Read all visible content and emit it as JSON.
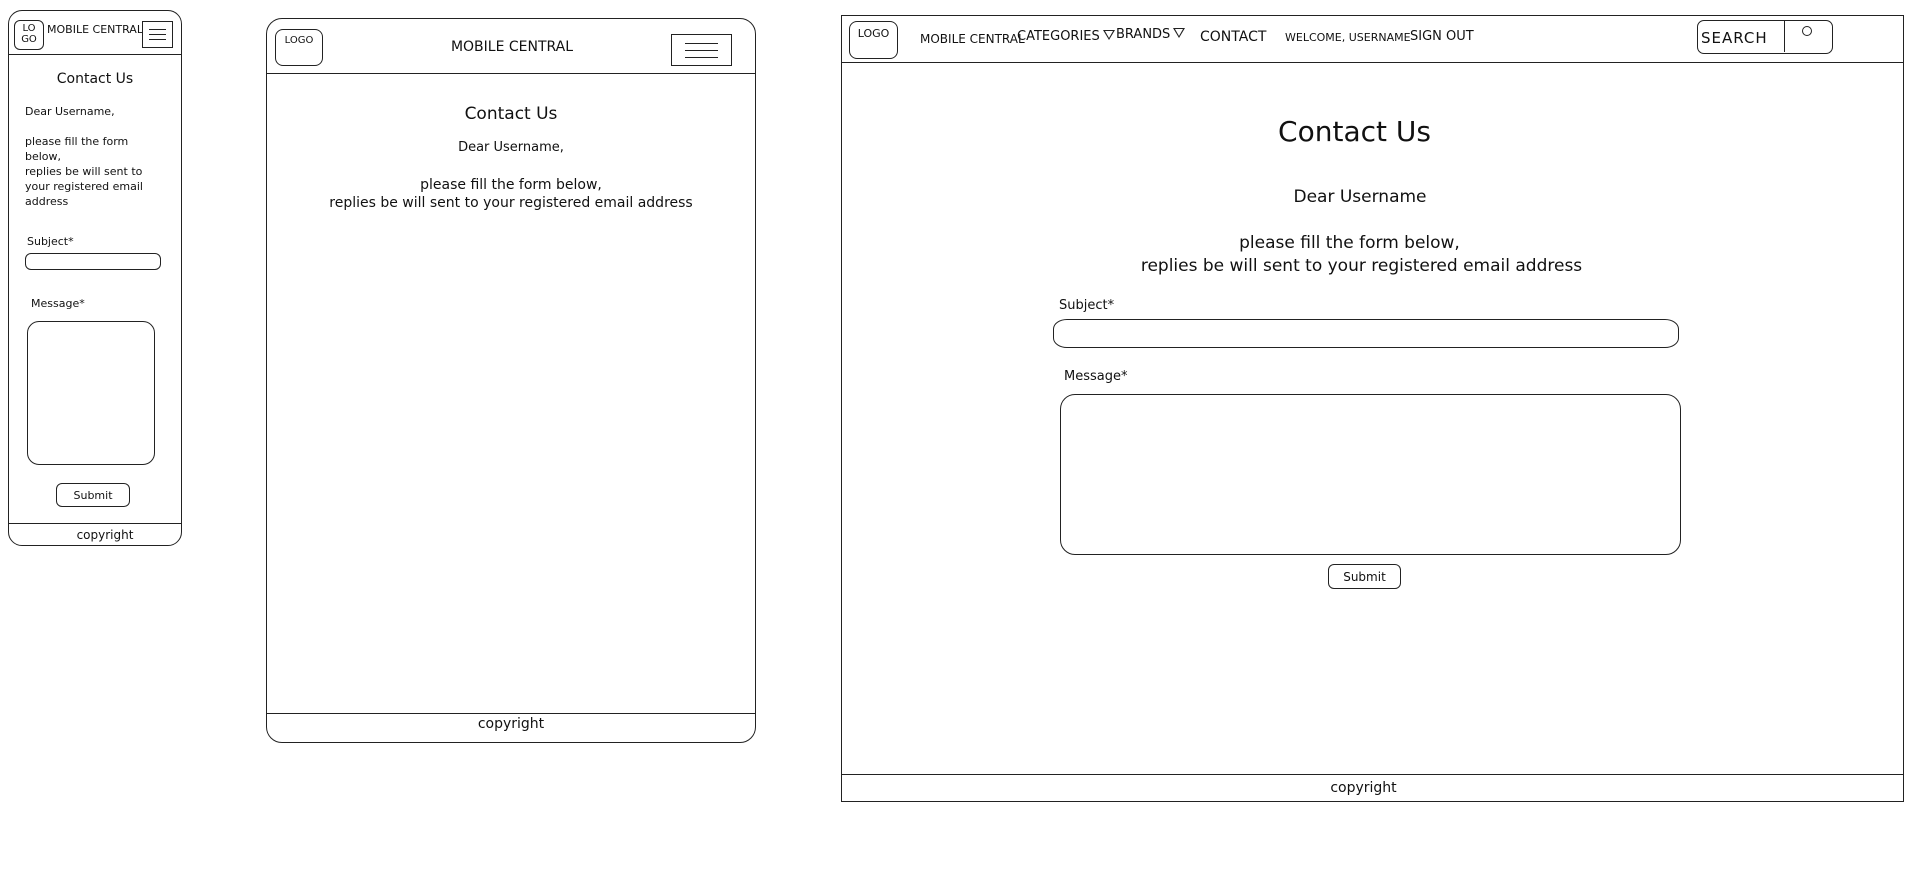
{
  "mobile": {
    "logo": "LO\nGO",
    "brand": "MOBILE CENTRAL",
    "page_title": "Contact Us",
    "greeting": "Dear Username,",
    "instructions_1": "please fill the form",
    "instructions_2": "below,",
    "instructions_3": "replies be will sent to",
    "instructions_4": "your registered email",
    "instructions_5": "address",
    "subject_label": "Subject*",
    "message_label": "Message*",
    "submit_label": "Submit",
    "footer": "copyright"
  },
  "tablet": {
    "logo": "LOGO",
    "brand": "MOBILE CENTRAL",
    "page_title": "Contact Us",
    "greeting": "Dear Username,",
    "instructions_1": "please fill the form below,",
    "instructions_2": "replies be will sent to your registered email address",
    "footer": "copyright"
  },
  "desktop": {
    "logo": "LOGO",
    "nav": {
      "brand": "MOBILE CENTRAL",
      "categories": "CATEGORIES",
      "brands": "BRANDS",
      "contact": "CONTACT",
      "welcome": "WELCOME, USERNAME",
      "sign_out": "SIGN OUT"
    },
    "search_label": "SEARCH",
    "page_title": "Contact Us",
    "greeting": "Dear Username",
    "instructions_1": "please fill the form below,",
    "instructions_2": "replies be will sent to your registered email address",
    "subject_label": "Subject*",
    "message_label": "Message*",
    "submit_label": "Submit",
    "footer": "copyright"
  },
  "icons": {
    "menu": "hamburger-menu-icon",
    "dropdown": "triangle-down-icon",
    "search": "magnifier-icon"
  }
}
